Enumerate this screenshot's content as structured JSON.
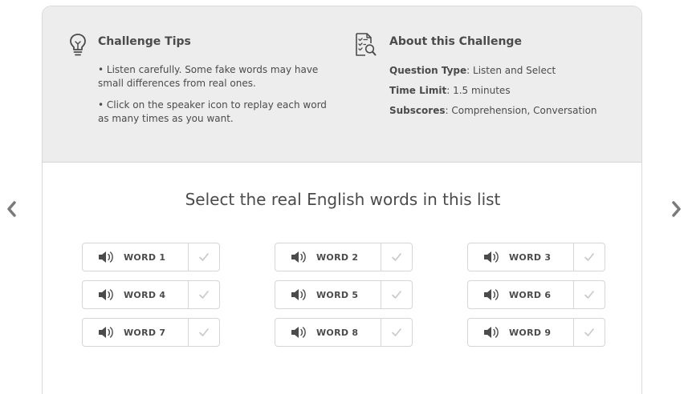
{
  "tips": {
    "heading": "Challenge Tips",
    "items": [
      "• Listen carefully. Some fake words may have small differences from real ones.",
      "• Click on the speaker icon to replay each word as many times as you want."
    ]
  },
  "about": {
    "heading": "About this Challenge",
    "question_type_label": "Question Type",
    "question_type_value": ": Listen and Select",
    "time_limit_label": "Time Limit",
    "time_limit_value": ": 1.5 minutes",
    "subscores_label": "Subscores",
    "subscores_value": ": Comprehension, Conversation"
  },
  "prompt": "Select the real English words in this list",
  "words": [
    {
      "label": "WORD 1",
      "checked": false
    },
    {
      "label": "WORD 2",
      "checked": false
    },
    {
      "label": "WORD 3",
      "checked": false
    },
    {
      "label": "WORD 4",
      "checked": false
    },
    {
      "label": "WORD 5",
      "checked": false
    },
    {
      "label": "WORD 6",
      "checked": false
    },
    {
      "label": "WORD 7",
      "checked": false
    },
    {
      "label": "WORD 8",
      "checked": false
    },
    {
      "label": "WORD 9",
      "checked": false
    }
  ],
  "icons": {
    "prev": "chevron-left-icon",
    "next": "chevron-right-icon",
    "tips": "lightbulb-icon",
    "about": "checklist-search-icon",
    "speaker": "speaker-icon",
    "check": "checkmark-icon"
  },
  "colors": {
    "tips_panel_bg": "#ededed",
    "text": "#4b4b4b",
    "border": "#d6d6d6",
    "check_inactive": "#c8c8c8"
  }
}
